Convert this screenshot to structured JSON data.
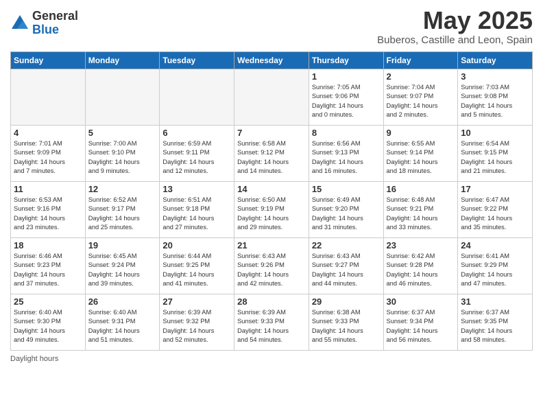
{
  "header": {
    "logo_general": "General",
    "logo_blue": "Blue",
    "month": "May 2025",
    "location": "Buberos, Castille and Leon, Spain"
  },
  "days_of_week": [
    "Sunday",
    "Monday",
    "Tuesday",
    "Wednesday",
    "Thursday",
    "Friday",
    "Saturday"
  ],
  "weeks": [
    [
      {
        "day": "",
        "info": "",
        "empty": true
      },
      {
        "day": "",
        "info": "",
        "empty": true
      },
      {
        "day": "",
        "info": "",
        "empty": true
      },
      {
        "day": "",
        "info": "",
        "empty": true
      },
      {
        "day": "1",
        "info": "Sunrise: 7:05 AM\nSunset: 9:06 PM\nDaylight: 14 hours\nand 0 minutes."
      },
      {
        "day": "2",
        "info": "Sunrise: 7:04 AM\nSunset: 9:07 PM\nDaylight: 14 hours\nand 2 minutes."
      },
      {
        "day": "3",
        "info": "Sunrise: 7:03 AM\nSunset: 9:08 PM\nDaylight: 14 hours\nand 5 minutes."
      }
    ],
    [
      {
        "day": "4",
        "info": "Sunrise: 7:01 AM\nSunset: 9:09 PM\nDaylight: 14 hours\nand 7 minutes."
      },
      {
        "day": "5",
        "info": "Sunrise: 7:00 AM\nSunset: 9:10 PM\nDaylight: 14 hours\nand 9 minutes."
      },
      {
        "day": "6",
        "info": "Sunrise: 6:59 AM\nSunset: 9:11 PM\nDaylight: 14 hours\nand 12 minutes."
      },
      {
        "day": "7",
        "info": "Sunrise: 6:58 AM\nSunset: 9:12 PM\nDaylight: 14 hours\nand 14 minutes."
      },
      {
        "day": "8",
        "info": "Sunrise: 6:56 AM\nSunset: 9:13 PM\nDaylight: 14 hours\nand 16 minutes."
      },
      {
        "day": "9",
        "info": "Sunrise: 6:55 AM\nSunset: 9:14 PM\nDaylight: 14 hours\nand 18 minutes."
      },
      {
        "day": "10",
        "info": "Sunrise: 6:54 AM\nSunset: 9:15 PM\nDaylight: 14 hours\nand 21 minutes."
      }
    ],
    [
      {
        "day": "11",
        "info": "Sunrise: 6:53 AM\nSunset: 9:16 PM\nDaylight: 14 hours\nand 23 minutes."
      },
      {
        "day": "12",
        "info": "Sunrise: 6:52 AM\nSunset: 9:17 PM\nDaylight: 14 hours\nand 25 minutes."
      },
      {
        "day": "13",
        "info": "Sunrise: 6:51 AM\nSunset: 9:18 PM\nDaylight: 14 hours\nand 27 minutes."
      },
      {
        "day": "14",
        "info": "Sunrise: 6:50 AM\nSunset: 9:19 PM\nDaylight: 14 hours\nand 29 minutes."
      },
      {
        "day": "15",
        "info": "Sunrise: 6:49 AM\nSunset: 9:20 PM\nDaylight: 14 hours\nand 31 minutes."
      },
      {
        "day": "16",
        "info": "Sunrise: 6:48 AM\nSunset: 9:21 PM\nDaylight: 14 hours\nand 33 minutes."
      },
      {
        "day": "17",
        "info": "Sunrise: 6:47 AM\nSunset: 9:22 PM\nDaylight: 14 hours\nand 35 minutes."
      }
    ],
    [
      {
        "day": "18",
        "info": "Sunrise: 6:46 AM\nSunset: 9:23 PM\nDaylight: 14 hours\nand 37 minutes."
      },
      {
        "day": "19",
        "info": "Sunrise: 6:45 AM\nSunset: 9:24 PM\nDaylight: 14 hours\nand 39 minutes."
      },
      {
        "day": "20",
        "info": "Sunrise: 6:44 AM\nSunset: 9:25 PM\nDaylight: 14 hours\nand 41 minutes."
      },
      {
        "day": "21",
        "info": "Sunrise: 6:43 AM\nSunset: 9:26 PM\nDaylight: 14 hours\nand 42 minutes."
      },
      {
        "day": "22",
        "info": "Sunrise: 6:43 AM\nSunset: 9:27 PM\nDaylight: 14 hours\nand 44 minutes."
      },
      {
        "day": "23",
        "info": "Sunrise: 6:42 AM\nSunset: 9:28 PM\nDaylight: 14 hours\nand 46 minutes."
      },
      {
        "day": "24",
        "info": "Sunrise: 6:41 AM\nSunset: 9:29 PM\nDaylight: 14 hours\nand 47 minutes."
      }
    ],
    [
      {
        "day": "25",
        "info": "Sunrise: 6:40 AM\nSunset: 9:30 PM\nDaylight: 14 hours\nand 49 minutes."
      },
      {
        "day": "26",
        "info": "Sunrise: 6:40 AM\nSunset: 9:31 PM\nDaylight: 14 hours\nand 51 minutes."
      },
      {
        "day": "27",
        "info": "Sunrise: 6:39 AM\nSunset: 9:32 PM\nDaylight: 14 hours\nand 52 minutes."
      },
      {
        "day": "28",
        "info": "Sunrise: 6:39 AM\nSunset: 9:33 PM\nDaylight: 14 hours\nand 54 minutes."
      },
      {
        "day": "29",
        "info": "Sunrise: 6:38 AM\nSunset: 9:33 PM\nDaylight: 14 hours\nand 55 minutes."
      },
      {
        "day": "30",
        "info": "Sunrise: 6:37 AM\nSunset: 9:34 PM\nDaylight: 14 hours\nand 56 minutes."
      },
      {
        "day": "31",
        "info": "Sunrise: 6:37 AM\nSunset: 9:35 PM\nDaylight: 14 hours\nand 58 minutes."
      }
    ]
  ],
  "footer": "Daylight hours"
}
